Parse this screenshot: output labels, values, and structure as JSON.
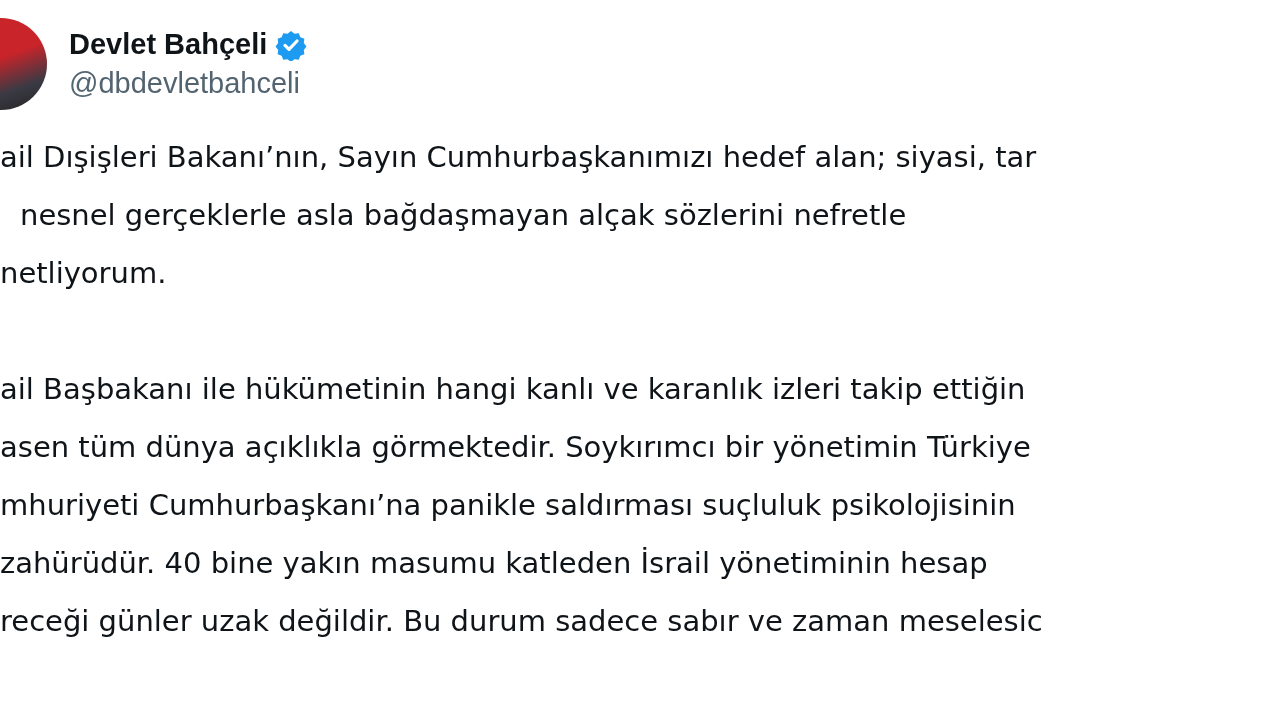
{
  "author": {
    "name": "Devlet Bahçeli",
    "handle": "@dbdevletbahceli",
    "verified": true
  },
  "paragraphs": [
    [
      "ail Dışişleri Bakanı’nın, Sayın Cumhurbaşkanımızı hedef alan; siyasi, tar",
      "nesnel gerçeklerle asla bağdaşmayan alçak sözlerini nefretle",
      "netliyorum."
    ],
    [
      "ail Başbakanı ile hükümetinin hangi kanlı ve karanlık izleri takip ettiğin",
      "asen tüm dünya açıklıkla görmektedir. Soykırımcı bir yönetimin Türkiye",
      "mhuriyeti Cumhurbaşkanı’na panikle saldırması suçluluk psikolojisinin",
      "zahürüdür. 40 bine yakın masumu katleden İsrail yönetiminin hesap",
      "receği günler uzak değildir. Bu durum sadece sabır ve zaman meselesic"
    ]
  ]
}
